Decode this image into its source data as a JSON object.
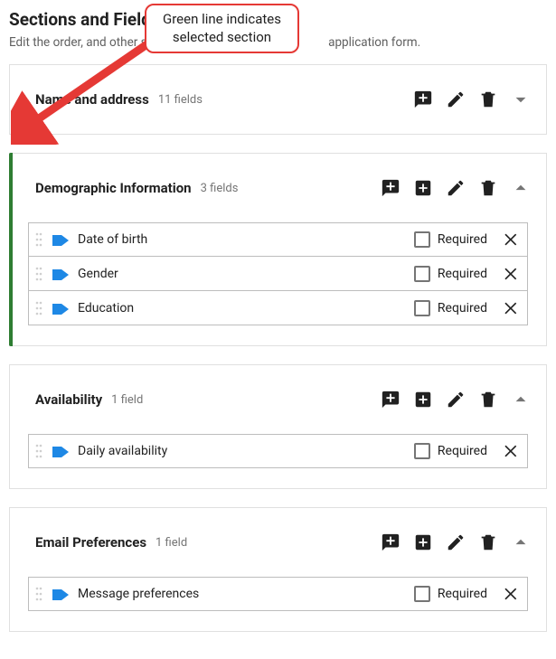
{
  "page": {
    "title": "Sections and Field Order",
    "subtitle_before": "Edit the order, and other se",
    "subtitle_after": " application form."
  },
  "callout": {
    "line1": "Green line indicates",
    "line2": "selected section"
  },
  "required_label": "Required",
  "sections": [
    {
      "title": "Name and address",
      "count_label": "11 fields",
      "selected": false,
      "expanded": false,
      "show_add_field": false,
      "fields": []
    },
    {
      "title": "Demographic Information",
      "count_label": "3 fields",
      "selected": true,
      "expanded": true,
      "show_add_field": true,
      "fields": [
        {
          "label": "Date of birth",
          "required": false
        },
        {
          "label": "Gender",
          "required": false
        },
        {
          "label": "Education",
          "required": false
        }
      ]
    },
    {
      "title": "Availability",
      "count_label": "1 field",
      "selected": false,
      "expanded": true,
      "show_add_field": true,
      "fields": [
        {
          "label": "Daily availability",
          "required": false
        }
      ]
    },
    {
      "title": "Email Preferences",
      "count_label": "1 field",
      "selected": false,
      "expanded": true,
      "show_add_field": true,
      "fields": [
        {
          "label": "Message preferences",
          "required": false
        }
      ]
    }
  ]
}
